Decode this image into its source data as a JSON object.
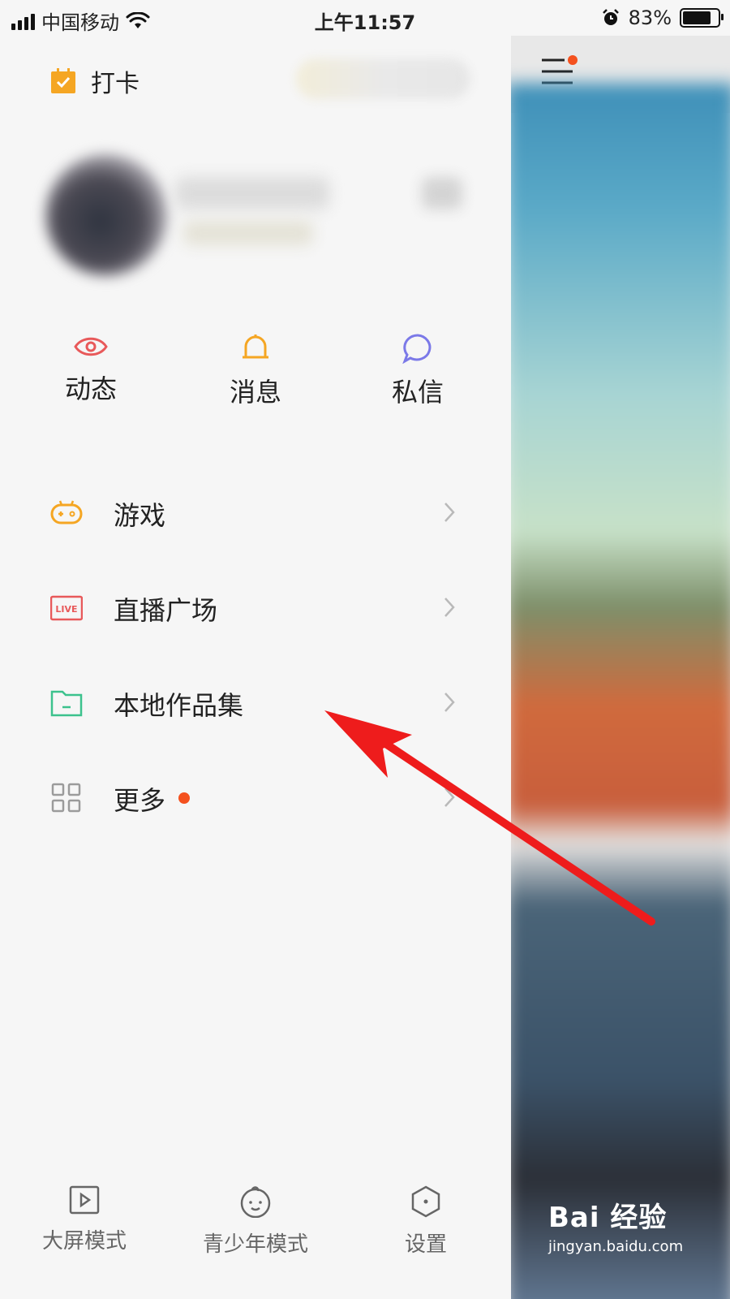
{
  "status_bar": {
    "carrier": "中国移动",
    "time": "上午11:57",
    "battery": "83%",
    "battery_level": 0.83
  },
  "drawer": {
    "checkin_label": "打卡",
    "quick_actions": [
      {
        "label": "动态",
        "icon": "eye-icon",
        "color": "#e8595a"
      },
      {
        "label": "消息",
        "icon": "bell-icon",
        "color": "#f5a623"
      },
      {
        "label": "私信",
        "icon": "chat-bubble-icon",
        "color": "#7b79e8"
      }
    ],
    "menu": [
      {
        "label": "游戏",
        "icon": "gamepad-icon",
        "color": "#f5a623"
      },
      {
        "label": "直播广场",
        "icon": "live-icon",
        "icon_text": "LIVE",
        "color": "#e8595a"
      },
      {
        "label": "本地作品集",
        "icon": "folder-icon",
        "color": "#3cc28d"
      },
      {
        "label": "更多",
        "icon": "grid-icon",
        "color": "#9b9b9b",
        "has_badge": true
      }
    ],
    "bottom": [
      {
        "label": "大屏模式",
        "icon": "play-screen-icon"
      },
      {
        "label": "青少年模式",
        "icon": "child-face-icon"
      },
      {
        "label": "设置",
        "icon": "hexagon-settings-icon"
      }
    ]
  },
  "watermark": {
    "logo": "Bai 经验",
    "url": "jingyan.baidu.com"
  },
  "colors": {
    "accent": "#f4511e",
    "drawer_bg": "#f6f6f6",
    "arrow": "#ee1c1c"
  }
}
